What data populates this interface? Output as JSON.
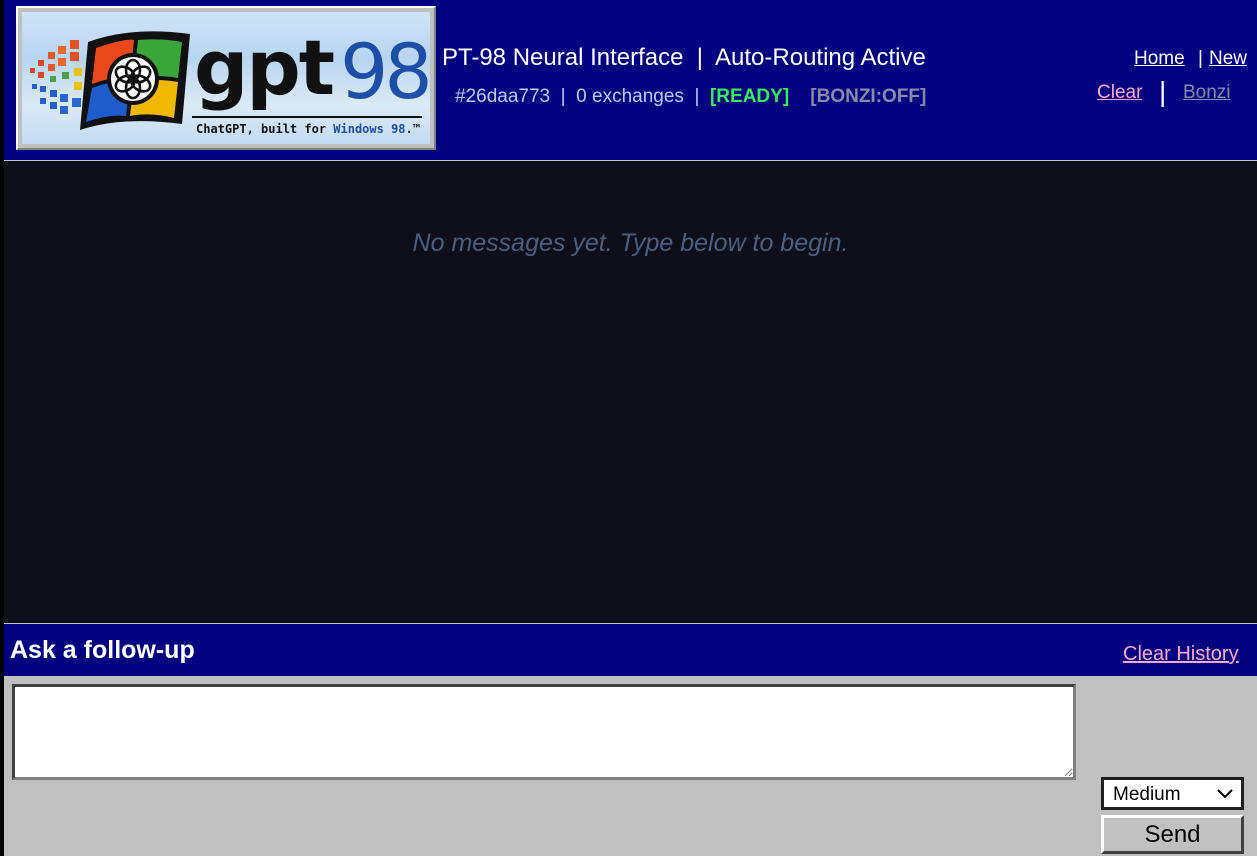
{
  "header": {
    "logo": {
      "word": "gpt",
      "number": "98",
      "tagline_prefix": "ChatGPT, built for ",
      "tagline_brand": "Windows 98",
      "tagline_suffix": ".™"
    },
    "title": "PT-98 Neural Interface  |  Auto-Routing Active",
    "session_id": "#26daa773",
    "separator": "|",
    "exchanges": "0 exchanges",
    "ready_status": "[READY]",
    "bonzi_status": "[BONZI:OFF]",
    "nav": {
      "home": "Home",
      "new": "New",
      "clear": "Clear",
      "bonzi": "Bonzi",
      "sep_small": "|",
      "sep_large": "|"
    }
  },
  "chat": {
    "empty_message": "No messages yet. Type below to begin."
  },
  "composer": {
    "title": "Ask a follow-up",
    "clear_history": "Clear History",
    "input_value": "",
    "input_placeholder": "",
    "model_selected": "Medium",
    "send_label": "Send"
  },
  "colors": {
    "header_bg": "#000080",
    "chat_bg": "#0f0f1c",
    "composer_bg": "#c0c0c0",
    "ready": "#33ee55",
    "bonzi_off": "#8a8aa8",
    "link_pink": "#ffaacc",
    "empty_text": "#4a5f80",
    "logo_blue": "#1e4fa8"
  },
  "icons": {
    "logo_mark": "openai-knot-icon",
    "windows_flag": "windows-flag-icon",
    "select_arrow": "chevron-down-icon",
    "resize_grip": "resize-grip-icon"
  }
}
